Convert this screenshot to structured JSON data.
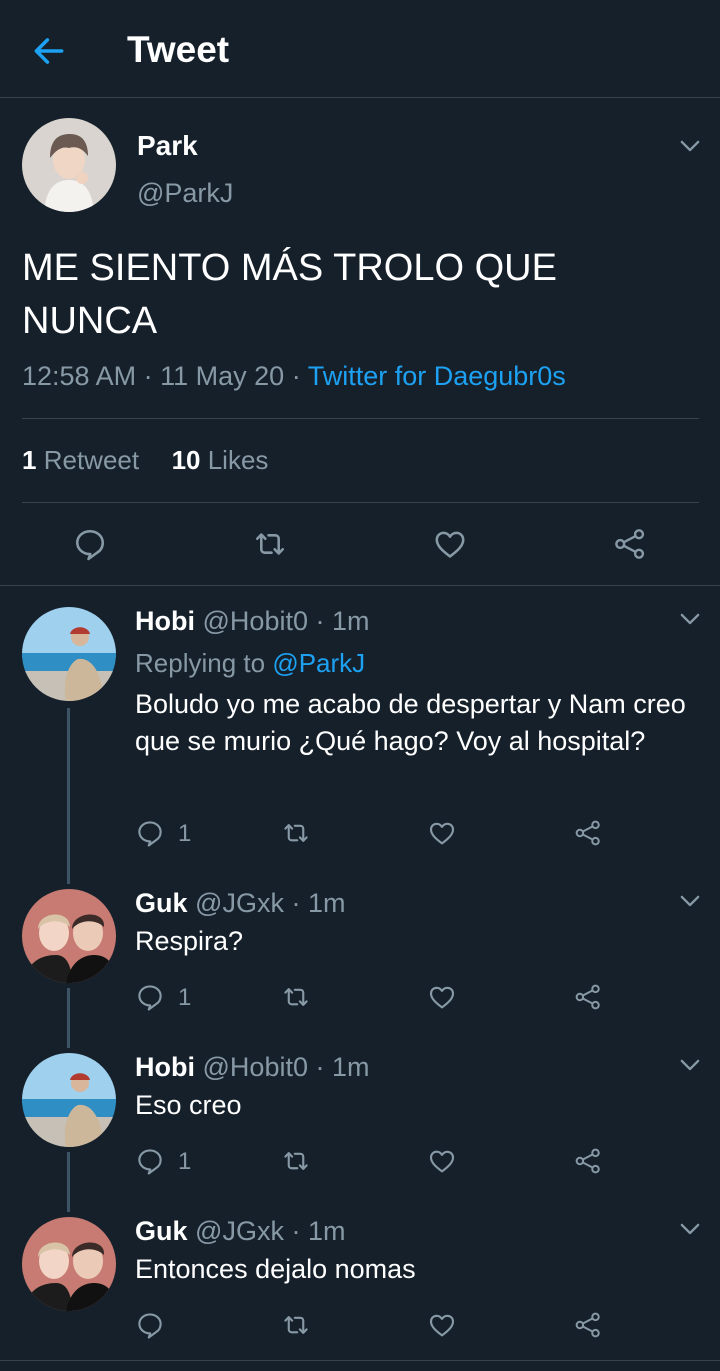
{
  "header": {
    "title": "Tweet"
  },
  "tweet": {
    "name": "Park",
    "handle": "@ParkJ",
    "text": "ME SIENTO MÁS TROLO QUE NUNCA",
    "time": "12:58 AM",
    "date": "11 May 20",
    "source": "Twitter for Daegubr0s",
    "retweet_count": "1",
    "retweet_label": "Retweet",
    "likes_count": "10",
    "likes_label": "Likes"
  },
  "replies": [
    {
      "name": "Hobi",
      "handle": "@Hobit0",
      "time": "1m",
      "replying_label": "Replying to",
      "replying_to": "@ParkJ",
      "text": "Boludo yo me acabo de despertar y Nam creo que se murio ¿Qué hago? Voy al hospital?",
      "reply_count": "1"
    },
    {
      "name": "Guk",
      "handle": "@JGxk",
      "time": "1m",
      "text": "Respira?",
      "reply_count": "1"
    },
    {
      "name": "Hobi",
      "handle": "@Hobit0",
      "time": "1m",
      "text": "Eso creo",
      "reply_count": "1"
    },
    {
      "name": "Guk",
      "handle": "@JGxk",
      "time": "1m",
      "text": "Entonces dejalo nomas",
      "reply_count": ""
    }
  ],
  "colors": {
    "background": "#15202b",
    "accent": "#1da1f2",
    "muted": "#8899a6",
    "divider": "#38444d"
  },
  "icons": [
    "back-arrow-icon",
    "chevron-down-icon",
    "reply-icon",
    "retweet-icon",
    "like-icon",
    "share-icon"
  ]
}
